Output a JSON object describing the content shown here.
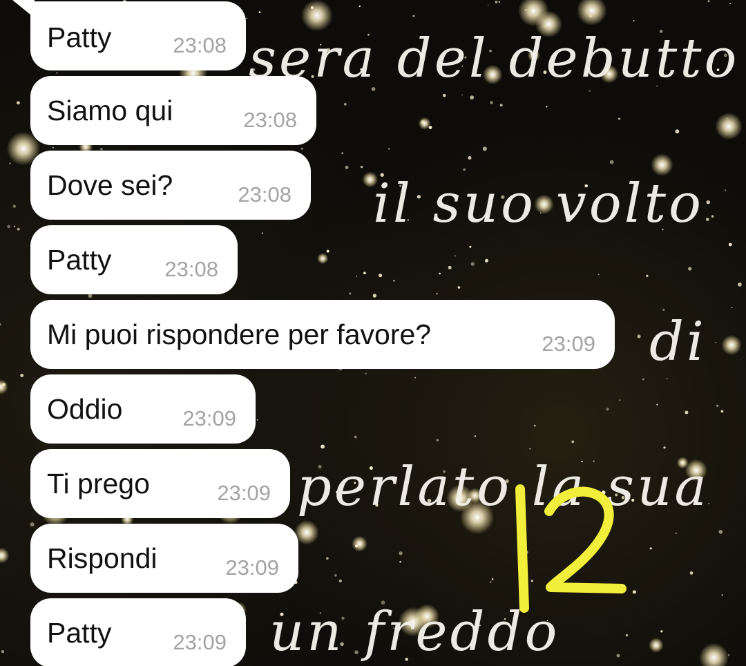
{
  "background": {
    "script_lines": [
      "sera del debutto",
      "il suo volto",
      "di",
      "perlato la sua",
      "un freddo"
    ]
  },
  "messages": [
    {
      "text": "Patty",
      "time": "23:08"
    },
    {
      "text": "Siamo qui",
      "time": "23:08"
    },
    {
      "text": "Dove sei?",
      "time": "23:08"
    },
    {
      "text": "Patty",
      "time": "23:08"
    },
    {
      "text": "Mi puoi rispondere per favore?",
      "time": "23:09"
    },
    {
      "text": "Oddio",
      "time": "23:09"
    },
    {
      "text": "Ti prego",
      "time": "23:09"
    },
    {
      "text": "Rispondi",
      "time": "23:09"
    },
    {
      "text": "Patty",
      "time": "23:09"
    }
  ],
  "annotation": {
    "text": "12",
    "color": "#f2ef3c"
  },
  "colors": {
    "bubble": "#ffffff",
    "timestamp": "#a3a3a3",
    "message_text": "#111111"
  }
}
